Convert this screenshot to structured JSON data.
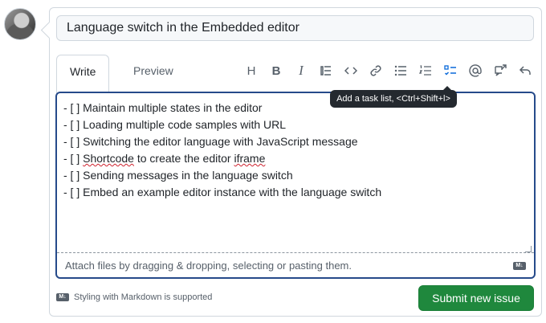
{
  "issue": {
    "title_value": "Language switch in the Embedded editor"
  },
  "tabs": {
    "write": "Write",
    "preview": "Preview"
  },
  "toolbar": {
    "heading": "H",
    "bold": "B",
    "italic": "I",
    "tooltip": "Add a task list, <Ctrl+Shift+l>"
  },
  "editor": {
    "lines": [
      "- [ ] Maintain multiple states in the editor",
      "- [ ] Loading multiple code samples with URL",
      "- [ ] Switching the editor language with JavaScript message",
      "- [ ] ",
      "- [ ] Sending messages in the language switch",
      "- [ ] Embed an example editor instance with the language switch"
    ],
    "line4_word1": "Shortcode",
    "line4_mid": " to create the editor ",
    "line4_word2": "iframe",
    "attach_text": "Attach files by dragging & dropping, selecting or pasting them."
  },
  "footer": {
    "markdown_note": "Styling with Markdown is supported",
    "submit_label": "Submit new issue",
    "md_badge": "M↓"
  }
}
